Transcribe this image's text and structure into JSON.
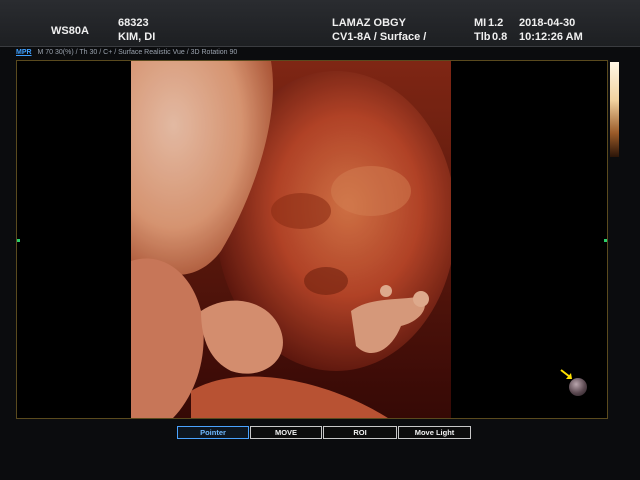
{
  "header": {
    "model": "WS80A",
    "patient_id": "68323",
    "patient_name": "KIM, DI",
    "clinic": "LAMAZ OBGY",
    "probe_preset": "CV1-8A / Surface /",
    "mi_label": "MI",
    "mi_value": "1.2",
    "tib_label": "Tlb",
    "tib_value": "0.8",
    "date": "2018-04-30",
    "time": "10:12:26 AM"
  },
  "info_line": {
    "tab": "MPR",
    "params": "M 70 30(%) / Th 30 / C+ / Surface Realistic Vue / 3D Rotation 90"
  },
  "toolbar": {
    "buttons": [
      {
        "label": "Pointer",
        "active": true
      },
      {
        "label": "MOVE",
        "active": false
      },
      {
        "label": "ROI",
        "active": false
      },
      {
        "label": "Move Light",
        "active": false
      }
    ]
  },
  "colors": {
    "accent_active": "#4aa3ff",
    "render_skin": "#c8502a",
    "center_marker": "#2ad06a",
    "light_arrow": "#ffe000"
  },
  "icons": {
    "light_source": "light-source-sphere-icon",
    "light_arrow": "arrow-icon"
  }
}
